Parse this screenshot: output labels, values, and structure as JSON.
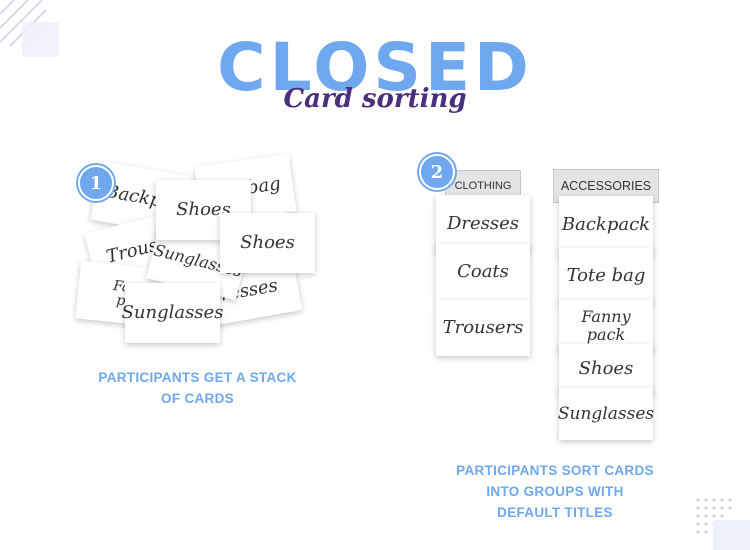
{
  "title": "CLOSED",
  "subtitle": "Card sorting",
  "step1": {
    "number": "1",
    "cards": [
      "Backpack",
      "Tote bag",
      "Shoes",
      "Trousers",
      "Sunglasses",
      "Shoes",
      "Fanny pack",
      "Dresses",
      "Sunglasses"
    ],
    "caption_line1": "PARTICIPANTS GET A STACK",
    "caption_line2": "OF CARDS"
  },
  "step2": {
    "number": "2",
    "groups": [
      {
        "title": "CLOTHING",
        "cards": [
          "Dresses",
          "Coats",
          "Trousers"
        ]
      },
      {
        "title": "ACCESSORIES",
        "cards": [
          "Backpack",
          "Tote bag",
          "Fanny pack",
          "Shoes",
          "Sunglasses"
        ]
      }
    ],
    "caption_line1": "PARTICIPANTS SORT CARDS",
    "caption_line2": "INTO GROUPS WITH",
    "caption_line3": "DEFAULT TITLES"
  },
  "colors": {
    "accent": "#6fa8ee",
    "subtitle": "#4a2f7c"
  }
}
